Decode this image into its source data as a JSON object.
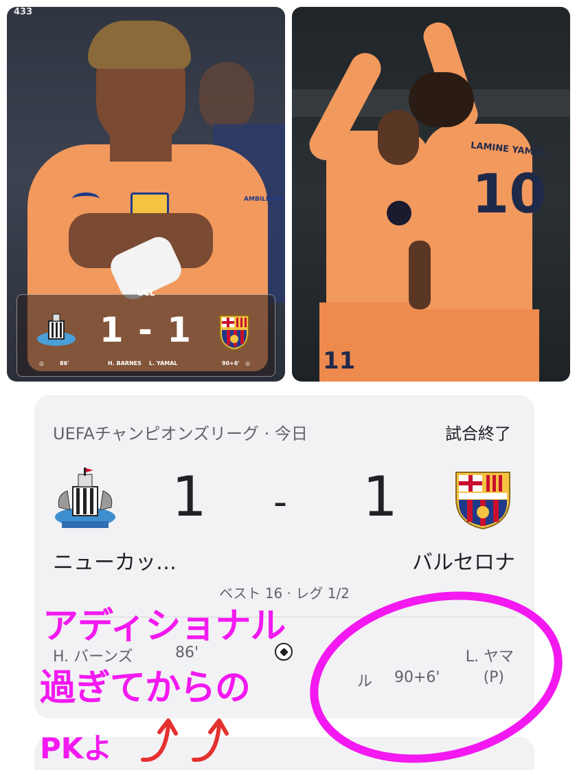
{
  "photo_left": {
    "watermark": "433",
    "overlay": {
      "competition": "UCL",
      "score": "1 - 1",
      "home_scorer": "H. BARNES",
      "home_minute": "86'",
      "away_scorer": "L. YAMAL",
      "away_minute": "90+6'"
    },
    "jersey_text": "AMBILIGHT"
  },
  "photo_right": {
    "jersey_number_main": "10",
    "jersey_name": "LAMINE YAMAL",
    "jersey_number_other": "11"
  },
  "match_card": {
    "competition_date": "UEFAチャンピオンズリーグ · 今日",
    "status": "試合終了",
    "home_team": "ニューカッ…",
    "away_team": "バルセロナ",
    "home_score": "1",
    "separator": "-",
    "away_score": "1",
    "round": "ベスト 16 · レグ 1/2",
    "home_scorer": "H. バーンズ",
    "home_minute": "86'",
    "away_scorer_line1": "L. ヤマ",
    "away_scorer_line2": "ル",
    "away_minute": "90+6'",
    "away_penalty": "(P)"
  },
  "annotation": {
    "line1": "アディショナル",
    "line2": "過ぎてからの",
    "line3": "PKよ",
    "circle_color": "#f319f0",
    "arrow_color": "#e53030"
  },
  "colors": {
    "barca_blue": "#1f3a8a",
    "barca_red": "#c8102e",
    "barca_gold": "#f5c242",
    "kit_orange": "#f2995e"
  }
}
